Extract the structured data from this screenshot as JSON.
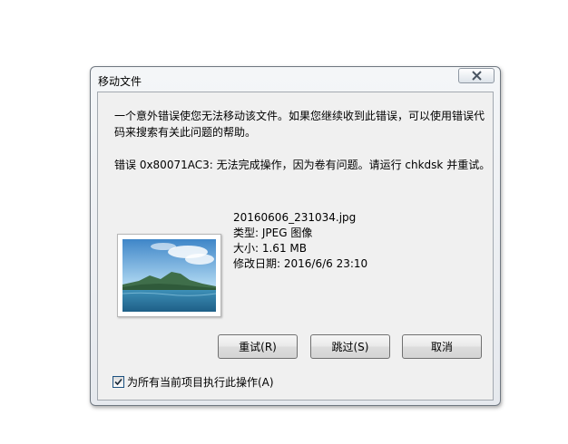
{
  "dialog": {
    "title": "移动文件",
    "close_icon": "close-x-icon",
    "message": "一个意外错误使您无法移动该文件。如果您继续收到此错误，可以使用错误代码来搜索有关此问题的帮助。",
    "error_text": "错误 0x80071AC3: 无法完成操作，因为卷有问题。请运行 chkdsk 并重试。",
    "file": {
      "name": "20160606_231034.jpg",
      "type": "类型: JPEG 图像",
      "size": "大小: 1.61 MB",
      "modified": "修改日期: 2016/6/6 23:10",
      "thumbnail": "landscape-thumbnail"
    },
    "buttons": {
      "retry": "重试(R)",
      "skip": "跳过(S)",
      "cancel": "取消"
    },
    "apply_all": {
      "label": "为所有当前项目执行此操作(A)",
      "checked": true
    }
  }
}
